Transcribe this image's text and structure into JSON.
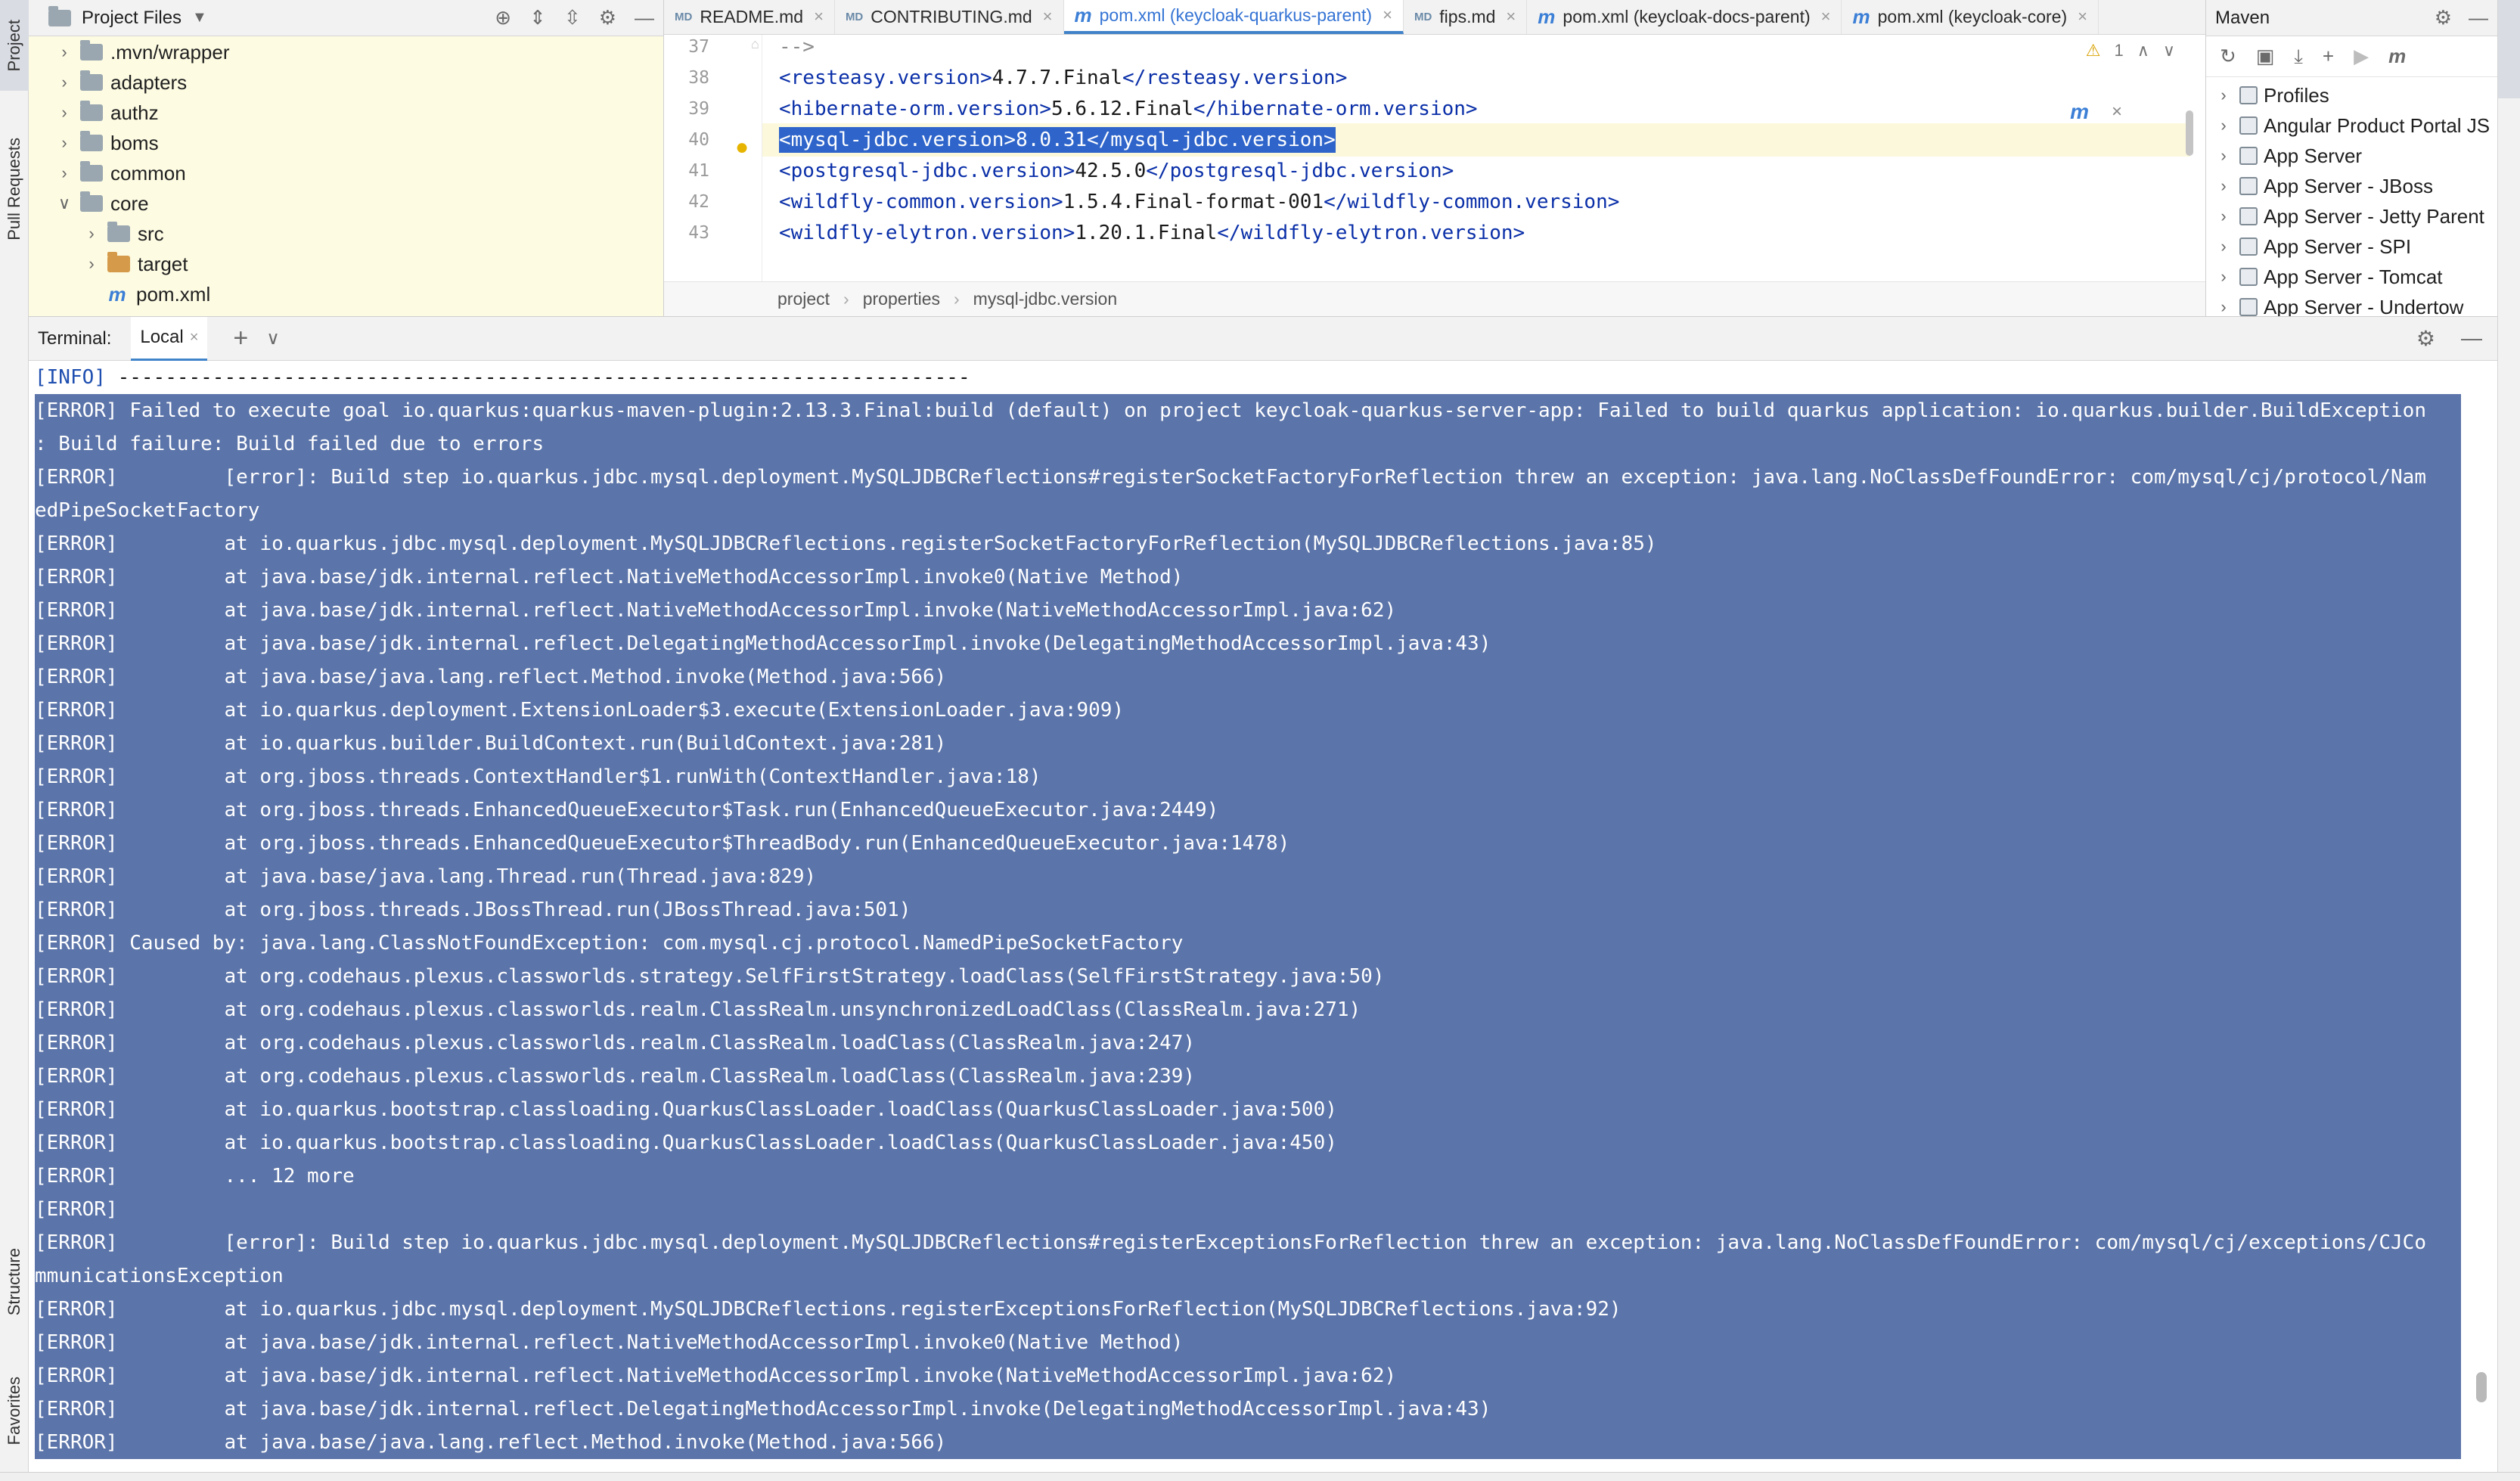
{
  "left_strip": {
    "top_tab": "Project",
    "mid_tab": "Pull Requests",
    "bottom_tabs": [
      "Structure",
      "Favorites"
    ]
  },
  "project": {
    "title": "Project Files",
    "tree": [
      {
        "label": ".mvn/wrapper",
        "indent": 1,
        "expanded": false,
        "kind": "folder"
      },
      {
        "label": "adapters",
        "indent": 1,
        "expanded": false,
        "kind": "folder"
      },
      {
        "label": "authz",
        "indent": 1,
        "expanded": false,
        "kind": "folder"
      },
      {
        "label": "boms",
        "indent": 1,
        "expanded": false,
        "kind": "folder"
      },
      {
        "label": "common",
        "indent": 1,
        "expanded": false,
        "kind": "folder"
      },
      {
        "label": "core",
        "indent": 1,
        "expanded": true,
        "kind": "folder"
      },
      {
        "label": "src",
        "indent": 2,
        "expanded": false,
        "kind": "folder"
      },
      {
        "label": "target",
        "indent": 2,
        "expanded": false,
        "kind": "folder-orange"
      },
      {
        "label": "pom.xml",
        "indent": 2,
        "expanded": null,
        "kind": "maven-file"
      }
    ]
  },
  "editor": {
    "tabs": [
      {
        "label": "README.md",
        "icon": "MD",
        "active": false
      },
      {
        "label": "CONTRIBUTING.md",
        "icon": "MD",
        "active": false
      },
      {
        "label": "pom.xml (keycloak-quarkus-parent)",
        "icon": "m",
        "active": true
      },
      {
        "label": "fips.md",
        "icon": "MD",
        "active": false
      },
      {
        "label": "pom.xml (keycloak-docs-parent)",
        "icon": "m",
        "active": false
      },
      {
        "label": "pom.xml (keycloak-core)",
        "icon": "m",
        "active": false
      }
    ],
    "warning_count": "1",
    "lines": [
      {
        "num": "37",
        "open": "",
        "value": "-->",
        "close": "",
        "selected": false
      },
      {
        "num": "38",
        "open": "<resteasy.version>",
        "value": "4.7.7.Final",
        "close": "</resteasy.version>",
        "selected": false
      },
      {
        "num": "39",
        "open": "<hibernate-orm.version>",
        "value": "5.6.12.Final",
        "close": "</hibernate-orm.version>",
        "selected": false
      },
      {
        "num": "40",
        "open": "<mysql-jdbc.version>",
        "value": "8.0.31",
        "close": "</mysql-jdbc.version>",
        "selected": true
      },
      {
        "num": "41",
        "open": "<postgresql-jdbc.version>",
        "value": "42.5.0",
        "close": "</postgresql-jdbc.version>",
        "selected": false
      },
      {
        "num": "42",
        "open": "<wildfly-common.version>",
        "value": "1.5.4.Final-format-001",
        "close": "</wildfly-common.version>",
        "selected": false
      },
      {
        "num": "43",
        "open": "<wildfly-elytron.version>",
        "value": "1.20.1.Final",
        "close": "</wildfly-elytron.version>",
        "selected": false
      }
    ],
    "breadcrumbs": [
      "project",
      "properties",
      "mysql-jdbc.version"
    ]
  },
  "maven": {
    "title": "Maven",
    "items": [
      "Profiles",
      "Angular Product Portal JS",
      "App Server",
      "App Server - JBoss",
      "App Server - Jetty Parent",
      "App Server - SPI",
      "App Server - Tomcat",
      "App Server - Undertow"
    ]
  },
  "terminal": {
    "label": "Terminal:",
    "tab": "Local",
    "lines": [
      {
        "pre": "[INFO]",
        "text": " ------------------------------------------------------------------------",
        "sel": false,
        "info": true
      },
      {
        "pre": "[ERROR]",
        "text": " Failed to execute goal io.quarkus:quarkus-maven-plugin:2.13.3.Final:build (default) on project keycloak-quarkus-server-app: Failed to build quarkus application: io.quarkus.builder.BuildException",
        "sel": true
      },
      {
        "pre": "",
        "text": ": Build failure: Build failed due to errors",
        "sel": true
      },
      {
        "pre": "[ERROR]",
        "text": "         [error]: Build step io.quarkus.jdbc.mysql.deployment.MySQLJDBCReflections#registerSocketFactoryForReflection threw an exception: java.lang.NoClassDefFoundError: com/mysql/cj/protocol/Nam",
        "sel": true
      },
      {
        "pre": "",
        "text": "edPipeSocketFactory",
        "sel": true
      },
      {
        "pre": "[ERROR]",
        "text": "         at io.quarkus.jdbc.mysql.deployment.MySQLJDBCReflections.registerSocketFactoryForReflection(MySQLJDBCReflections.java:85)",
        "sel": true
      },
      {
        "pre": "[ERROR]",
        "text": "         at java.base/jdk.internal.reflect.NativeMethodAccessorImpl.invoke0(Native Method)",
        "sel": true
      },
      {
        "pre": "[ERROR]",
        "text": "         at java.base/jdk.internal.reflect.NativeMethodAccessorImpl.invoke(NativeMethodAccessorImpl.java:62)",
        "sel": true
      },
      {
        "pre": "[ERROR]",
        "text": "         at java.base/jdk.internal.reflect.DelegatingMethodAccessorImpl.invoke(DelegatingMethodAccessorImpl.java:43)",
        "sel": true
      },
      {
        "pre": "[ERROR]",
        "text": "         at java.base/java.lang.reflect.Method.invoke(Method.java:566)",
        "sel": true
      },
      {
        "pre": "[ERROR]",
        "text": "         at io.quarkus.deployment.ExtensionLoader$3.execute(ExtensionLoader.java:909)",
        "sel": true
      },
      {
        "pre": "[ERROR]",
        "text": "         at io.quarkus.builder.BuildContext.run(BuildContext.java:281)",
        "sel": true
      },
      {
        "pre": "[ERROR]",
        "text": "         at org.jboss.threads.ContextHandler$1.runWith(ContextHandler.java:18)",
        "sel": true
      },
      {
        "pre": "[ERROR]",
        "text": "         at org.jboss.threads.EnhancedQueueExecutor$Task.run(EnhancedQueueExecutor.java:2449)",
        "sel": true
      },
      {
        "pre": "[ERROR]",
        "text": "         at org.jboss.threads.EnhancedQueueExecutor$ThreadBody.run(EnhancedQueueExecutor.java:1478)",
        "sel": true
      },
      {
        "pre": "[ERROR]",
        "text": "         at java.base/java.lang.Thread.run(Thread.java:829)",
        "sel": true
      },
      {
        "pre": "[ERROR]",
        "text": "         at org.jboss.threads.JBossThread.run(JBossThread.java:501)",
        "sel": true
      },
      {
        "pre": "[ERROR]",
        "text": " Caused by: java.lang.ClassNotFoundException: com.mysql.cj.protocol.NamedPipeSocketFactory",
        "sel": true
      },
      {
        "pre": "[ERROR]",
        "text": "         at org.codehaus.plexus.classworlds.strategy.SelfFirstStrategy.loadClass(SelfFirstStrategy.java:50)",
        "sel": true
      },
      {
        "pre": "[ERROR]",
        "text": "         at org.codehaus.plexus.classworlds.realm.ClassRealm.unsynchronizedLoadClass(ClassRealm.java:271)",
        "sel": true
      },
      {
        "pre": "[ERROR]",
        "text": "         at org.codehaus.plexus.classworlds.realm.ClassRealm.loadClass(ClassRealm.java:247)",
        "sel": true
      },
      {
        "pre": "[ERROR]",
        "text": "         at org.codehaus.plexus.classworlds.realm.ClassRealm.loadClass(ClassRealm.java:239)",
        "sel": true
      },
      {
        "pre": "[ERROR]",
        "text": "         at io.quarkus.bootstrap.classloading.QuarkusClassLoader.loadClass(QuarkusClassLoader.java:500)",
        "sel": true
      },
      {
        "pre": "[ERROR]",
        "text": "         at io.quarkus.bootstrap.classloading.QuarkusClassLoader.loadClass(QuarkusClassLoader.java:450)",
        "sel": true
      },
      {
        "pre": "[ERROR]",
        "text": "         ... 12 more",
        "sel": true
      },
      {
        "pre": "[ERROR]",
        "text": "",
        "sel": true
      },
      {
        "pre": "[ERROR]",
        "text": "         [error]: Build step io.quarkus.jdbc.mysql.deployment.MySQLJDBCReflections#registerExceptionsForReflection threw an exception: java.lang.NoClassDefFoundError: com/mysql/cj/exceptions/CJCo",
        "sel": true
      },
      {
        "pre": "",
        "text": "mmunicationsException",
        "sel": true
      },
      {
        "pre": "[ERROR]",
        "text": "         at io.quarkus.jdbc.mysql.deployment.MySQLJDBCReflections.registerExceptionsForReflection(MySQLJDBCReflections.java:92)",
        "sel": true
      },
      {
        "pre": "[ERROR]",
        "text": "         at java.base/jdk.internal.reflect.NativeMethodAccessorImpl.invoke0(Native Method)",
        "sel": true
      },
      {
        "pre": "[ERROR]",
        "text": "         at java.base/jdk.internal.reflect.NativeMethodAccessorImpl.invoke(NativeMethodAccessorImpl.java:62)",
        "sel": true
      },
      {
        "pre": "[ERROR]",
        "text": "         at java.base/jdk.internal.reflect.DelegatingMethodAccessorImpl.invoke(DelegatingMethodAccessorImpl.java:43)",
        "sel": true
      },
      {
        "pre": "[ERROR]",
        "text": "         at java.base/java.lang.reflect.Method.invoke(Method.java:566)",
        "sel": true
      }
    ]
  },
  "colors": {
    "selection": "#5b74a9",
    "accent": "#3574d4",
    "project_bg": "#fdfbe2",
    "xml_tag": "#0a2fa8"
  }
}
